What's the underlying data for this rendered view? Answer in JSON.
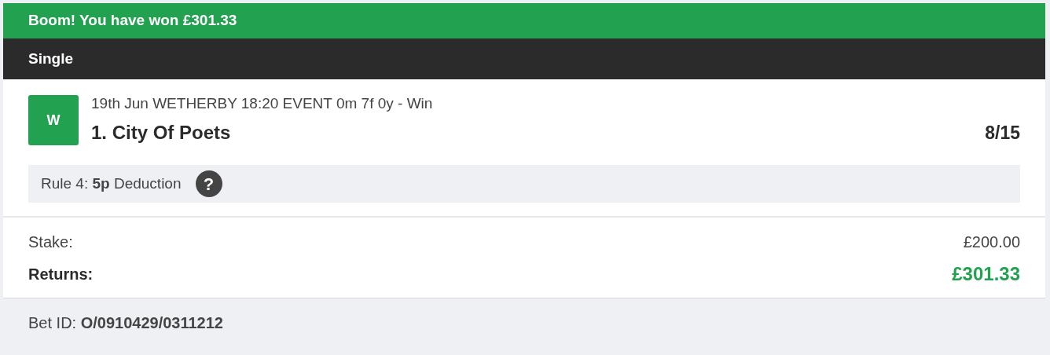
{
  "banner": {
    "text": "Boom! You have won £301.33"
  },
  "bet_type": "Single",
  "selection": {
    "result_badge": "W",
    "event": "19th Jun WETHERBY 18:20 EVENT 0m 7f 0y - Win",
    "runner": "1. City Of Poets",
    "odds": "8/15"
  },
  "rule4": {
    "text": "Rule 4: **5p** Deduction",
    "help": "?"
  },
  "summary": [
    {
      "label": "Stake:",
      "value": "£200.00",
      "kind": "plain"
    },
    {
      "label": "Returns:",
      "value": "£301.33",
      "kind": "highlight"
    }
  ],
  "bet_id": "Bet ID: **O/0910429/0311212**"
}
